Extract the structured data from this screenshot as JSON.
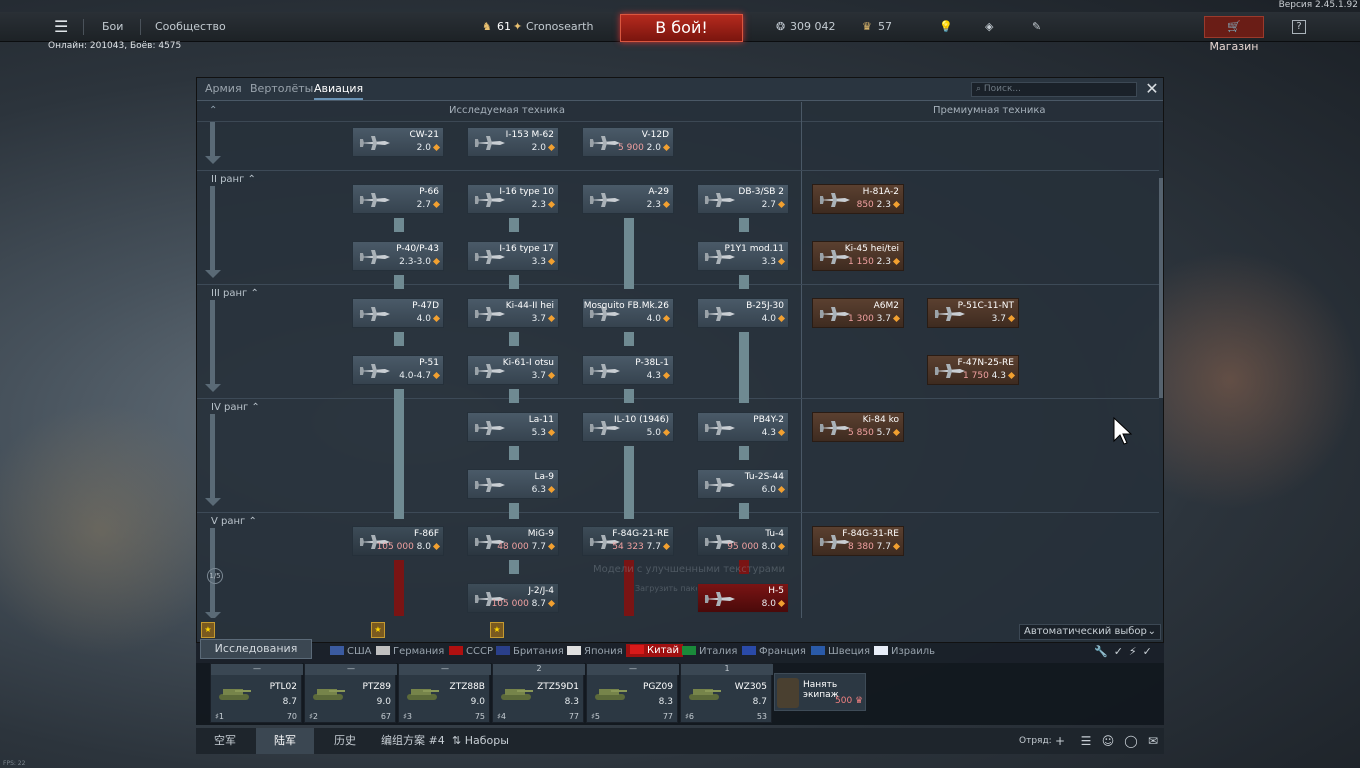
{
  "version": "Версия 2.45.1.92",
  "topbar": {
    "menu_icon": "hamburger-icon",
    "battles": "Бои",
    "community": "Сообщество",
    "level": "61",
    "username": "Cronosearth",
    "battle_button": "В бой!",
    "silver": "309 042",
    "gold": "57",
    "shop": "Магазин",
    "help": "?"
  },
  "online": "Онлайн: 201043, Боёв: 4575",
  "panel": {
    "tabs": [
      "Армия",
      "Вертолёты",
      "Авиация"
    ],
    "active_tab": "Авиация",
    "search_placeholder": "Поиск...",
    "close": "✕",
    "header_research": "Исследуемая техника",
    "header_premium": "Премиумная техника",
    "ranks": [
      "II ранг",
      "III ранг",
      "IV ранг",
      "V ранг"
    ],
    "rank_circle": "1/5",
    "ghost_text": "Модели с улучшенными текстурами",
    "ghost_sub": "Загрузить пакеты",
    "auto_select": "Автоматический выбор"
  },
  "vehicles": [
    {
      "name": "CW-21",
      "br": "2.0",
      "rp": ""
    },
    {
      "name": "I-153 M-62",
      "br": "2.0",
      "rp": ""
    },
    {
      "name": "V-12D",
      "br": "2.0",
      "rp": "5 900"
    },
    {
      "name": "P-66",
      "br": "2.7",
      "rp": ""
    },
    {
      "name": "I-16 type 10",
      "br": "2.3",
      "rp": ""
    },
    {
      "name": "A-29",
      "br": "2.3",
      "rp": ""
    },
    {
      "name": "DB-3/SB 2",
      "br": "2.7",
      "rp": ""
    },
    {
      "name": "H-81A-2",
      "br": "2.3",
      "rp": "850"
    },
    {
      "name": "P-40/P-43",
      "br": "2.3-3.0",
      "rp": ""
    },
    {
      "name": "I-16 type 17",
      "br": "3.3",
      "rp": ""
    },
    {
      "name": "P1Y1 mod.11",
      "br": "3.3",
      "rp": ""
    },
    {
      "name": "Ki-45 hei/tei",
      "br": "2.3",
      "rp": "1 150"
    },
    {
      "name": "P-47D",
      "br": "4.0",
      "rp": ""
    },
    {
      "name": "Ki-44-II hei",
      "br": "3.7",
      "rp": ""
    },
    {
      "name": "Mosquito FB.Mk.26",
      "br": "4.0",
      "rp": ""
    },
    {
      "name": "B-25J-30",
      "br": "4.0",
      "rp": ""
    },
    {
      "name": "A6M2",
      "br": "3.7",
      "rp": "1 300"
    },
    {
      "name": "P-51C-11-NT",
      "br": "3.7",
      "rp": ""
    },
    {
      "name": "P-51",
      "br": "4.0-4.7",
      "rp": ""
    },
    {
      "name": "Ki-61-I otsu",
      "br": "3.7",
      "rp": ""
    },
    {
      "name": "P-38L-1",
      "br": "4.3",
      "rp": ""
    },
    {
      "name": "F-47N-25-RE",
      "br": "4.3",
      "rp": "1 750"
    },
    {
      "name": "La-11",
      "br": "5.3",
      "rp": ""
    },
    {
      "name": "IL-10 (1946)",
      "br": "5.0",
      "rp": ""
    },
    {
      "name": "PB4Y-2",
      "br": "4.3",
      "rp": ""
    },
    {
      "name": "Ki-84 ko",
      "br": "5.7",
      "rp": "5 850"
    },
    {
      "name": "La-9",
      "br": "6.3",
      "rp": ""
    },
    {
      "name": "Tu-2S-44",
      "br": "6.0",
      "rp": ""
    },
    {
      "name": "F-86F",
      "br": "8.0",
      "rp": "105 000"
    },
    {
      "name": "MiG-9",
      "br": "7.7",
      "rp": "48 000"
    },
    {
      "name": "F-84G-21-RE",
      "br": "7.7",
      "rp": "54 323"
    },
    {
      "name": "Tu-4",
      "br": "8.0",
      "rp": "95 000"
    },
    {
      "name": "F-84G-31-RE",
      "br": "7.7",
      "rp": "8 380"
    },
    {
      "name": "J-2/J-4",
      "br": "8.7",
      "rp": "105 000"
    },
    {
      "name": "H-5",
      "br": "8.0",
      "rp": ""
    }
  ],
  "nations": {
    "research_tab": "Исследования",
    "list": [
      {
        "label": "США",
        "color": "#3b5ba0"
      },
      {
        "label": "Германия",
        "color": "#c0c0c0"
      },
      {
        "label": "СССР",
        "color": "#b01010"
      },
      {
        "label": "Британия",
        "color": "#2a3f8a"
      },
      {
        "label": "Япония",
        "color": "#e0e0e0"
      },
      {
        "label": "Китай",
        "color": "#d81a1a"
      },
      {
        "label": "Италия",
        "color": "#1a8a3a"
      },
      {
        "label": "Франция",
        "color": "#2a4aa8"
      },
      {
        "label": "Швеция",
        "color": "#2a5aa8"
      },
      {
        "label": "Израиль",
        "color": "#e8eef8"
      }
    ],
    "active": "Китай"
  },
  "crew": [
    {
      "top": "—",
      "name": "PTL02",
      "br": "8.7",
      "num": "1",
      "count": "70"
    },
    {
      "top": "—",
      "name": "PTZ89",
      "br": "9.0",
      "num": "2",
      "count": "67"
    },
    {
      "top": "—",
      "name": "ZTZ88B",
      "br": "9.0",
      "num": "3",
      "count": "75"
    },
    {
      "top": "2",
      "name": "ZTZ59D1",
      "br": "8.3",
      "num": "4",
      "count": "77"
    },
    {
      "top": "—",
      "name": "PGZ09",
      "br": "8.3",
      "num": "5",
      "count": "77"
    },
    {
      "top": "1",
      "name": "WZ305",
      "br": "8.7",
      "num": "6",
      "count": "53"
    }
  ],
  "hire_crew": {
    "label": "Нанять экипаж",
    "price": "500"
  },
  "bottom": {
    "tab1": "空军",
    "tab2": "陆军",
    "tab3": "历史",
    "preset": "编组方案 #4",
    "sets": "Наборы",
    "squad": "Отряд:"
  },
  "fps": "FPS: 22"
}
